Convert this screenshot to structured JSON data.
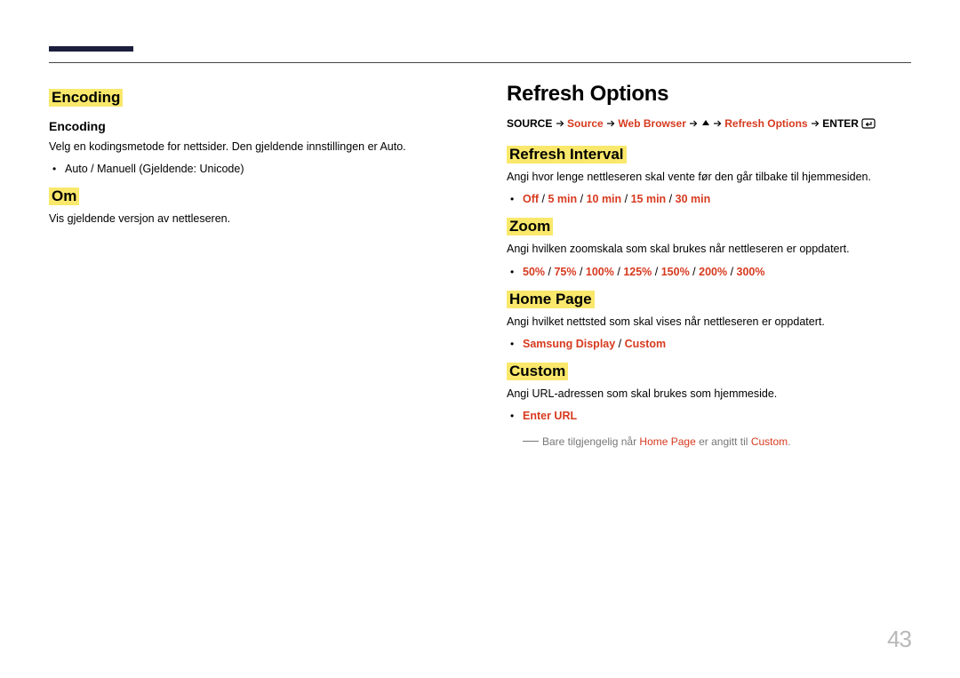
{
  "left": {
    "encoding_heading": "Encoding",
    "encoding_sub": "Encoding",
    "encoding_desc": "Velg en kodingsmetode for nettsider. Den gjeldende innstillingen er Auto.",
    "encoding_opt": "Auto / Manuell (Gjeldende: Unicode)",
    "om_heading": "Om",
    "om_desc": "Vis gjeldende versjon av nettleseren."
  },
  "right": {
    "title": "Refresh Options",
    "path": {
      "p1": "SOURCE",
      "p2": "Source",
      "p3": "Web Browser",
      "p4": "Refresh Options",
      "p5": "ENTER"
    },
    "refresh_interval": {
      "heading": "Refresh Interval",
      "desc": "Angi hvor lenge nettleseren skal vente før den går tilbake til hjemmesiden.",
      "o1": "Off",
      "o2": "5 min",
      "o3": "10 min",
      "o4": "15 min",
      "o5": "30 min"
    },
    "zoom": {
      "heading": "Zoom",
      "desc": "Angi hvilken zoomskala som skal brukes når nettleseren er oppdatert.",
      "o1": "50%",
      "o2": "75%",
      "o3": "100%",
      "o4": "125%",
      "o5": "150%",
      "o6": "200%",
      "o7": "300%"
    },
    "home_page": {
      "heading": "Home Page",
      "desc": "Angi hvilket nettsted som skal vises når nettleseren er oppdatert.",
      "o1": "Samsung Display",
      "o2": "Custom"
    },
    "custom": {
      "heading": "Custom",
      "desc": "Angi URL-adressen som skal brukes som hjemmeside.",
      "o1": "Enter URL",
      "note_pre": "Bare tilgjengelig når ",
      "note_hp": "Home Page",
      "note_mid": " er angitt til ",
      "note_cu": "Custom",
      "note_post": "."
    }
  },
  "sep": " / ",
  "page_number": "43"
}
